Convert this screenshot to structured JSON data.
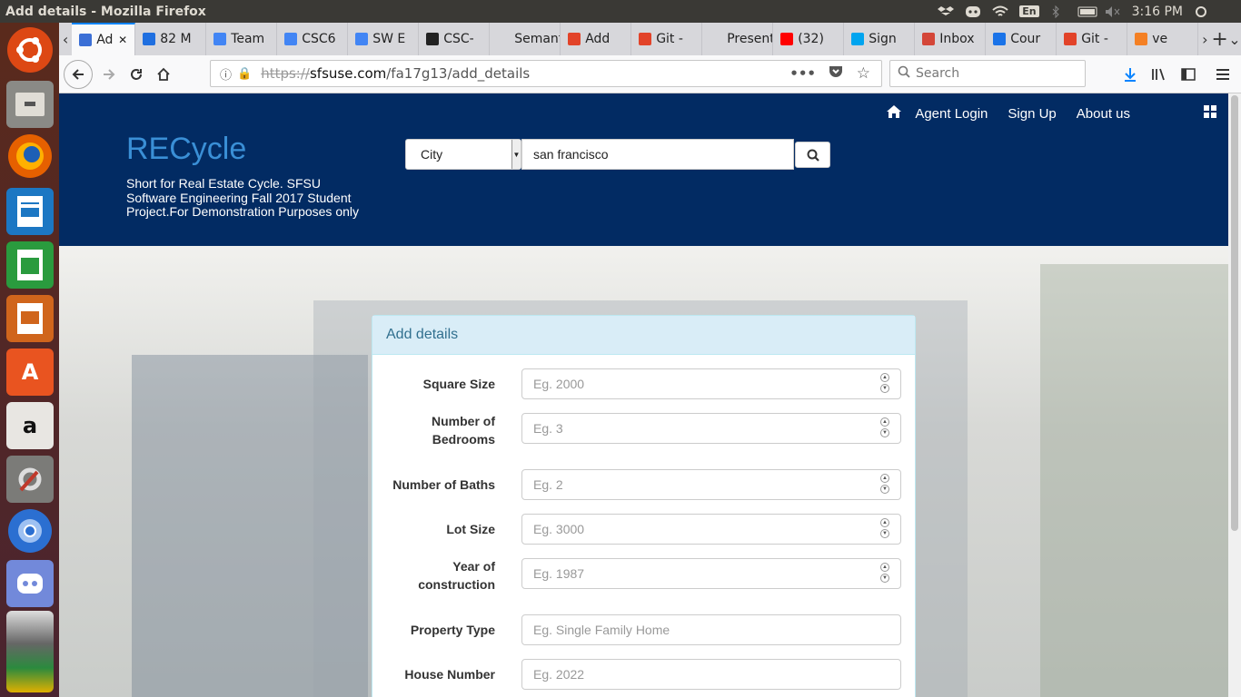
{
  "os": {
    "window_title": "Add details - Mozilla Firefox",
    "lang": "En",
    "time": "3:16 PM"
  },
  "tabs": [
    {
      "label": "Ad",
      "color": "#3b6fd6"
    },
    {
      "label": "82 M",
      "color": "#1f6fe0"
    },
    {
      "label": "Team",
      "color": "#4285f4"
    },
    {
      "label": "CSC6",
      "color": "#4285f4"
    },
    {
      "label": "SW E",
      "color": "#4285f4"
    },
    {
      "label": "CSC-",
      "color": "#222222"
    },
    {
      "label": "Semanti",
      "color": "#d7d7db"
    },
    {
      "label": "Add",
      "color": "#e24329"
    },
    {
      "label": "Git -",
      "color": "#e24329"
    },
    {
      "label": "Present",
      "color": "#d7d7db"
    },
    {
      "label": "(32)",
      "color": "#ff0000"
    },
    {
      "label": "Sign",
      "color": "#00a4ef"
    },
    {
      "label": "Inbox",
      "color": "#d44638"
    },
    {
      "label": "Cour",
      "color": "#1a73e8"
    },
    {
      "label": "Git -",
      "color": "#e24329"
    },
    {
      "label": "ve",
      "color": "#f48024"
    }
  ],
  "urlbar": {
    "scheme": "https://",
    "host": "sfsuse.com",
    "path": "/fa17g13/add_details",
    "search_placeholder": "Search"
  },
  "header": {
    "brand": "RECycle",
    "tagline": "Short for Real Estate Cycle. SFSU Software Engineering Fall 2017 Student Project.For Demonstration Purposes only",
    "nav": {
      "agent_login": "Agent Login",
      "sign_up": "Sign Up",
      "about": "About us"
    },
    "search": {
      "select_value": "City",
      "query": "san francisco"
    }
  },
  "form": {
    "title": "Add details",
    "fields": [
      {
        "label": "Square Size",
        "placeholder": "Eg. 2000",
        "spinner": true
      },
      {
        "label": "Number of Bedrooms",
        "placeholder": "Eg. 3",
        "spinner": true
      },
      {
        "label": "Number of Baths",
        "placeholder": "Eg. 2",
        "spinner": true
      },
      {
        "label": "Lot Size",
        "placeholder": "Eg. 3000",
        "spinner": true
      },
      {
        "label": "Year of construction",
        "placeholder": "Eg. 1987",
        "spinner": true
      },
      {
        "label": "Property Type",
        "placeholder": "Eg. Single Family Home",
        "spinner": false
      },
      {
        "label": "House Number",
        "placeholder": "Eg. 2022",
        "spinner": false
      }
    ]
  },
  "launcher": [
    "ubuntu-icon",
    "files-icon",
    "firefox-icon",
    "writer-icon",
    "calc-icon",
    "impress-icon",
    "software-center-icon",
    "amazon-icon",
    "settings-icon",
    "chromium-icon",
    "discord-icon",
    "stacked-apps-icon"
  ]
}
